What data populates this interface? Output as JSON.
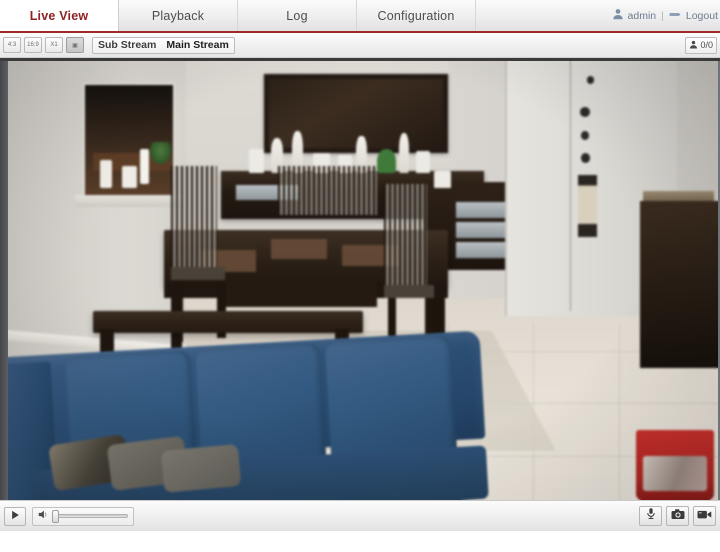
{
  "nav": {
    "tabs": [
      {
        "label": "Live View",
        "active": true
      },
      {
        "label": "Playback",
        "active": false
      },
      {
        "label": "Log",
        "active": false
      },
      {
        "label": "Configuration",
        "active": false
      }
    ],
    "account": {
      "user": "admin",
      "separator": "|",
      "logout_label": "Logout",
      "user_icon": "user-icon",
      "logout_icon": "logout-icon"
    },
    "active_tab_color": "#8e2323",
    "underline_color": "#9e2b2b"
  },
  "toolbar": {
    "ratio_buttons": [
      {
        "name": "aspect-4-3-button",
        "label": "4:3"
      },
      {
        "name": "aspect-16-9-button",
        "label": "16:9"
      },
      {
        "name": "aspect-x1-button",
        "label": "X1"
      },
      {
        "name": "aspect-fit-button",
        "label": "▣"
      }
    ],
    "stream": {
      "sub_label": "Sub Stream",
      "main_label": "Main Stream",
      "selected": "Main Stream"
    },
    "viewer_count": {
      "icon": "user-count-icon",
      "value": "0/0"
    }
  },
  "video": {
    "scene_description": "Live camera view of a dining room",
    "aspect_indicator": "",
    "objects": [
      "dining table",
      "bench",
      "chairs",
      "sideboard",
      "mirror",
      "blue sectional sofa",
      "pillows",
      "white door",
      "dark cabinet",
      "red laundry basket",
      "tiled floor",
      "pass-through window"
    ]
  },
  "controls": {
    "play": {
      "icon": "play-icon",
      "label": "Play"
    },
    "audio": {
      "icon": "speaker-icon",
      "label": "Volume",
      "value": 8
    },
    "right_buttons": [
      {
        "name": "microphone-button",
        "icon": "microphone-icon",
        "label": "Two-way Audio"
      },
      {
        "name": "snapshot-button",
        "icon": "camera-icon",
        "label": "Capture"
      },
      {
        "name": "record-button",
        "icon": "record-icon",
        "label": "Start Recording"
      }
    ]
  }
}
